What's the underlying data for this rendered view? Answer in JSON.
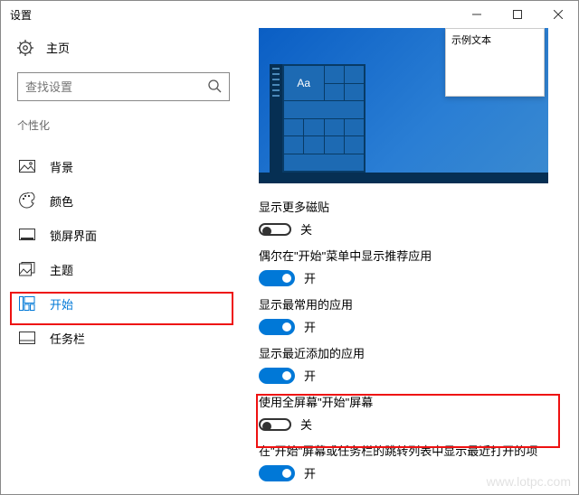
{
  "window": {
    "title": "设置"
  },
  "winbuttons": {
    "min": "－",
    "max": "▢",
    "close": "✕"
  },
  "home": {
    "label": "主页"
  },
  "search": {
    "placeholder": "查找设置"
  },
  "section": "个性化",
  "nav": [
    {
      "label": "背景"
    },
    {
      "label": "颜色"
    },
    {
      "label": "锁屏界面"
    },
    {
      "label": "主题"
    },
    {
      "label": "开始"
    },
    {
      "label": "任务栏"
    }
  ],
  "popup": {
    "title": "示例文本"
  },
  "preview": {
    "tile_label": "Aa"
  },
  "settings": [
    {
      "label": "显示更多磁贴",
      "on": false,
      "text": "关"
    },
    {
      "label": "偶尔在\"开始\"菜单中显示推荐应用",
      "on": true,
      "text": "开"
    },
    {
      "label": "显示最常用的应用",
      "on": true,
      "text": "开"
    },
    {
      "label": "显示最近添加的应用",
      "on": true,
      "text": "开"
    },
    {
      "label": "使用全屏幕\"开始\"屏幕",
      "on": false,
      "text": "关"
    },
    {
      "label": "在\"开始\"屏幕或任务栏的跳转列表中显示最近打开的项",
      "on": true,
      "text": "开"
    }
  ],
  "watermark": "www.lotpc.com"
}
